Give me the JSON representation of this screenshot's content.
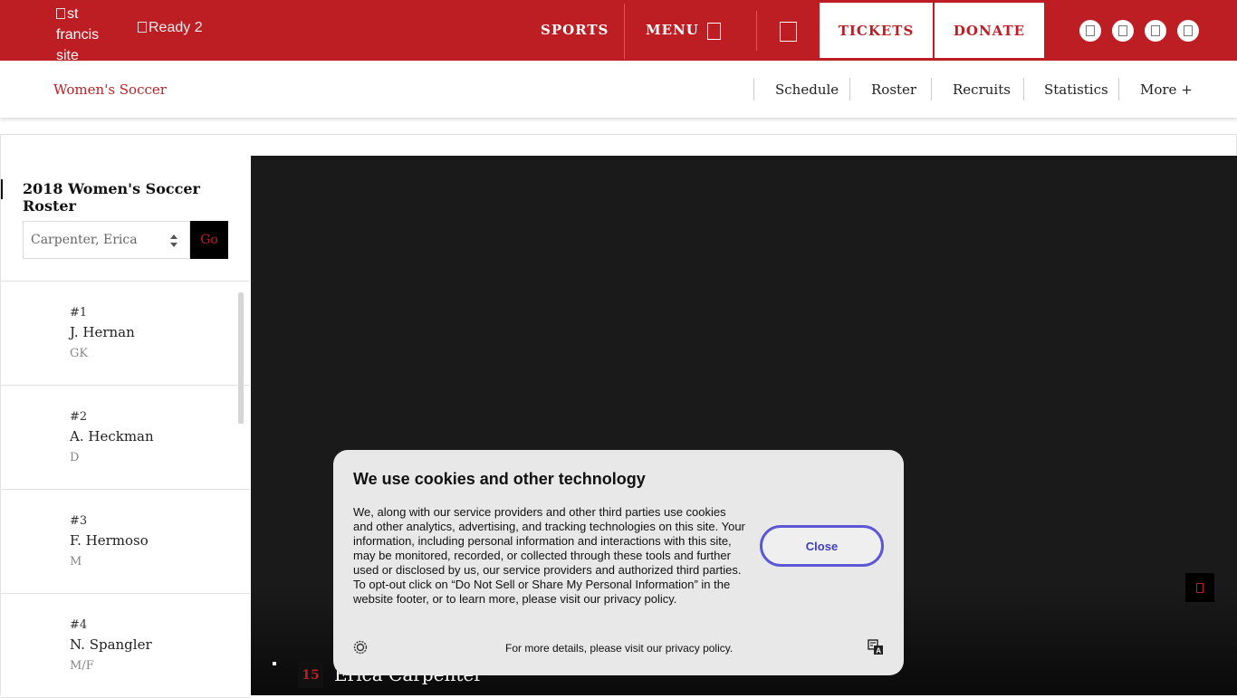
{
  "header": {
    "logo_alt": "st francis site",
    "ready_alt": "Ready 2",
    "nav_sports": "SPORTS",
    "nav_menu": "MENU",
    "tickets_label": "TICKETS",
    "donate_label": "DONATE",
    "brand_color": "#bd1e24"
  },
  "subnav": {
    "sport": "Women's Soccer",
    "items": [
      "Schedule",
      "Roster",
      "Recruits",
      "Statistics",
      "More +"
    ]
  },
  "sidebar": {
    "title": "2018 Women's Soccer Roster",
    "select_value": "Carpenter, Erica",
    "go_label": "Go",
    "players": [
      {
        "num": "#1",
        "name": "J. Hernan",
        "pos": "GK"
      },
      {
        "num": "#2",
        "name": "A. Heckman",
        "pos": "D"
      },
      {
        "num": "#3",
        "name": "F. Hermoso",
        "pos": "M"
      },
      {
        "num": "#4",
        "name": "N. Spangler",
        "pos": "M/F"
      }
    ]
  },
  "hero": {
    "jersey_number": "15",
    "player_name": "Erica Carpenter"
  },
  "cookie": {
    "title": "We use cookies and other technology",
    "body": "We, along with our service providers and other third parties use cookies and other analytics, advertising, and tracking technologies on this site. Your information, including personal information and interactions with this site, may be monitored, recorded, or collected through these tools and further used or disclosed by us, our service providers and authorized third parties. To opt-out click on “Do Not Sell or Share My Personal Information” in the website footer, or to learn more, please visit our privacy policy.",
    "close_label": "Close",
    "footer": "For more details, please visit our privacy policy."
  }
}
